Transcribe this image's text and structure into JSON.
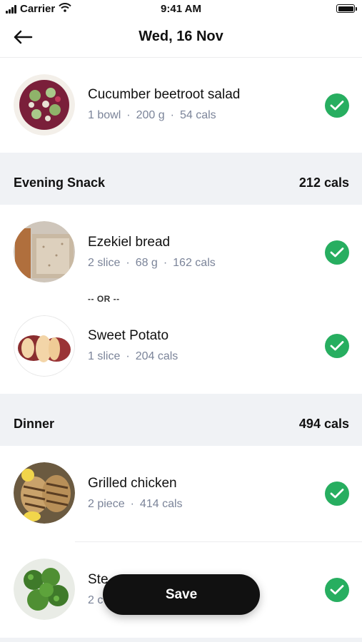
{
  "status_bar": {
    "carrier": "Carrier",
    "time": "9:41 AM"
  },
  "header": {
    "title": "Wed, 16 Nov"
  },
  "items_top": [
    {
      "name": "Cucumber beetroot salad",
      "qty": "1 bowl",
      "weight": "200 g",
      "cals": "54 cals"
    }
  ],
  "evening_snack": {
    "title": "Evening Snack",
    "cals": "212 cals",
    "items": [
      {
        "name": "Ezekiel bread",
        "qty": "2 slice",
        "weight": "68 g",
        "cals": "162 cals"
      },
      {
        "name": "Sweet Potato",
        "qty": "1 slice",
        "cals": "204 cals"
      }
    ],
    "or_label": "-- OR --"
  },
  "dinner": {
    "title": "Dinner",
    "cals": "494 cals",
    "items": [
      {
        "name": "Grilled chicken",
        "qty": "2 piece",
        "cals": "414 cals"
      },
      {
        "name": "Ste",
        "qty": "2 c"
      }
    ]
  },
  "save_label": "Save",
  "colors": {
    "accent_green": "#27ae60",
    "section_bg": "#f0f2f5",
    "meta_gray": "#7b8499"
  }
}
